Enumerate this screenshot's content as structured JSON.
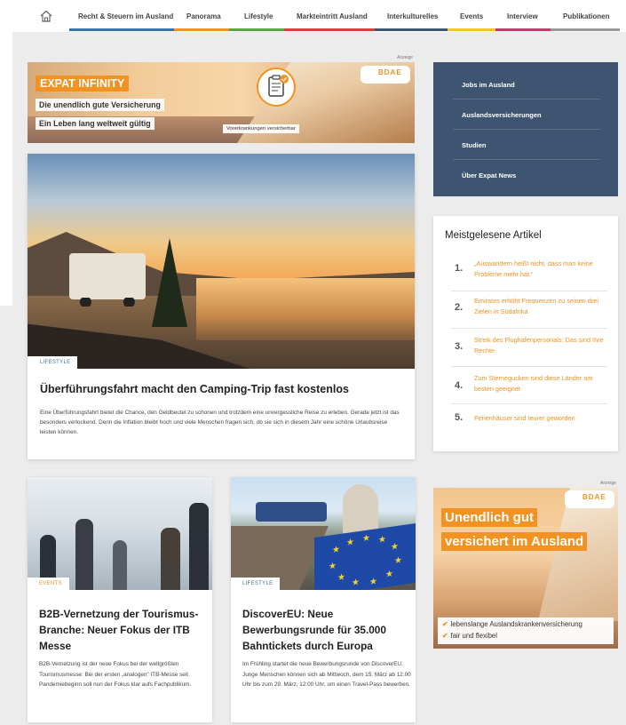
{
  "nav": {
    "home_icon": "home-icon",
    "items": [
      {
        "label": "Recht & Steuern im Ausland",
        "color": "#3a73a8"
      },
      {
        "label": "Panorama",
        "color": "#f29222"
      },
      {
        "label": "Lifestyle",
        "color": "#5aa543"
      },
      {
        "label": "Markteintritt Ausland",
        "color": "#d64040"
      },
      {
        "label": "Interkulturelles",
        "color": "#3d5570"
      },
      {
        "label": "Events",
        "color": "#f2c330"
      },
      {
        "label": "Interview",
        "color": "#c23a6a"
      },
      {
        "label": "Publikationen",
        "color": "#999999"
      }
    ]
  },
  "ad_label": "Anzeige",
  "top_ad": {
    "headline": "EXPAT INFINITY",
    "line1": "Die unendlich gute Versicherung",
    "line2": "Ein Leben lang weltweit gültig",
    "caption": "Vorerkrankungen versicherbar",
    "logo_text": "BDAE"
  },
  "hero": {
    "badge": "LIFESTYLE",
    "title": "Überführungsfahrt macht den Camping-Trip fast kostenlos",
    "text": "Eine Überführungsfahrt bietet die Chance, den Geldbeutel zu schonen und trotzdem eine unvergessliche Reise zu erleben. Gerade jetzt ist das besonders verlockend. Denn die Inflation bleibt hoch und viele Menschen fragen sich, ob sie sich in diesem Jahr eine schöne Urlaubsreise leisten können."
  },
  "menu": {
    "items": [
      "Jobs im Ausland",
      "Auslandsversicherungen",
      "Studien",
      "Über Expat News"
    ]
  },
  "popular": {
    "title": "Meistgelesene Artikel",
    "items": [
      {
        "num": "1.",
        "text": "„Auswandern heißt nicht, dass man keine Probleme mehr hat.“"
      },
      {
        "num": "2.",
        "text": "Emirates erhöht Frequenzen zu seinen drei Zielen in Südafrika"
      },
      {
        "num": "3.",
        "text": "Streik des Flughafenpersonals: Das sind Ihre Rechte"
      },
      {
        "num": "4.",
        "text": "Zum Sternegucken sind diese Länder am besten geeignet"
      },
      {
        "num": "5.",
        "text": "Ferienhäuser sind teurer geworden"
      }
    ]
  },
  "card1": {
    "badge": "EVENTS",
    "title": "B2B-Vernetzung der Tourismus-Branche: Neuer Fokus der ITB Messe",
    "text": "B2B-Vernetzung ist der neue Fokus bei der weltgrößten Tourismusmesse: Bei der ersten „analogen“ ITB-Messe seit Pandemiebeginn soll nun der Fokus klar aufs Fachpublikum."
  },
  "card2": {
    "badge": "LIFESTYLE",
    "title": "DiscoverEU: Neue Bewerbungsrunde für 35.000 Bahntickets durch Europa",
    "text": "Im Frühling startet die neue Bewerbungsrunde von DiscoverEU: Junge Menschen können sich ab Mittwoch, dem 15. März ab 12.00 Uhr bis zum 29. März, 12:00 Uhr, um einen Travel-Pass bewerben."
  },
  "side_ad": {
    "line1": "Unendlich gut",
    "line2": "versichert im Ausland",
    "bullet1": "lebenslange Auslandskrankenversicherung",
    "bullet2": "fair und flexibel",
    "logo_text": "BDAE"
  }
}
